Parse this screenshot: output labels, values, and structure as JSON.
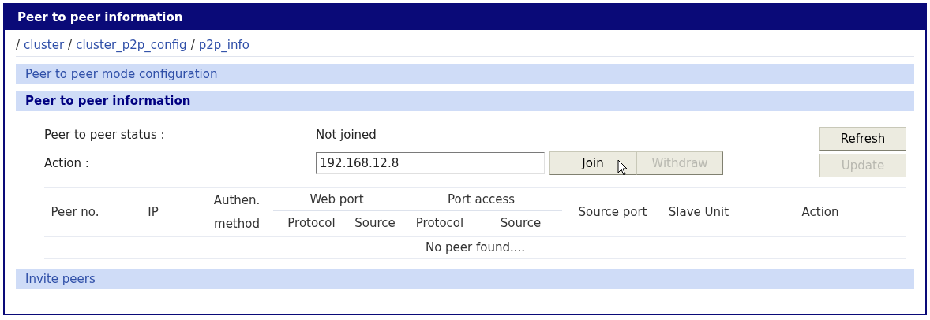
{
  "window": {
    "title": "Peer to peer information"
  },
  "breadcrumb": [
    {
      "separator": "/",
      "label": "cluster"
    },
    {
      "separator": "/",
      "label": "cluster_p2p_config"
    },
    {
      "separator": "/",
      "label": "p2p_info"
    }
  ],
  "sections": [
    {
      "title": "Peer to peer mode configuration",
      "expanded": false
    },
    {
      "title": "Peer to peer information",
      "expanded": true
    }
  ],
  "status": {
    "label": "Peer to peer status :",
    "value": "Not joined"
  },
  "action": {
    "label": "Action :",
    "value": "192.168.12.8"
  },
  "buttons": [
    {
      "label": "Join",
      "disabled": false
    },
    {
      "label": "Withdraw",
      "disabled": true
    }
  ],
  "side_buttons": [
    {
      "label": "Refresh",
      "disabled": false
    },
    {
      "label": "Update",
      "disabled": true
    }
  ],
  "table": {
    "columns": [
      {
        "label": "Peer no."
      },
      {
        "label": "IP"
      },
      {
        "label": "Authen. method"
      },
      {
        "label": "Web port",
        "children": [
          {
            "label": "Protocol"
          },
          {
            "label": "Source"
          }
        ]
      },
      {
        "label": "Port access",
        "children": [
          {
            "label": "Protocol"
          },
          {
            "label": "Source"
          }
        ]
      },
      {
        "label": "Source port"
      },
      {
        "label": "Slave Unit"
      },
      {
        "label": "Action"
      }
    ],
    "empty_message": "No peer found...."
  },
  "footer_section": {
    "title": "Invite peers",
    "expanded": false
  }
}
